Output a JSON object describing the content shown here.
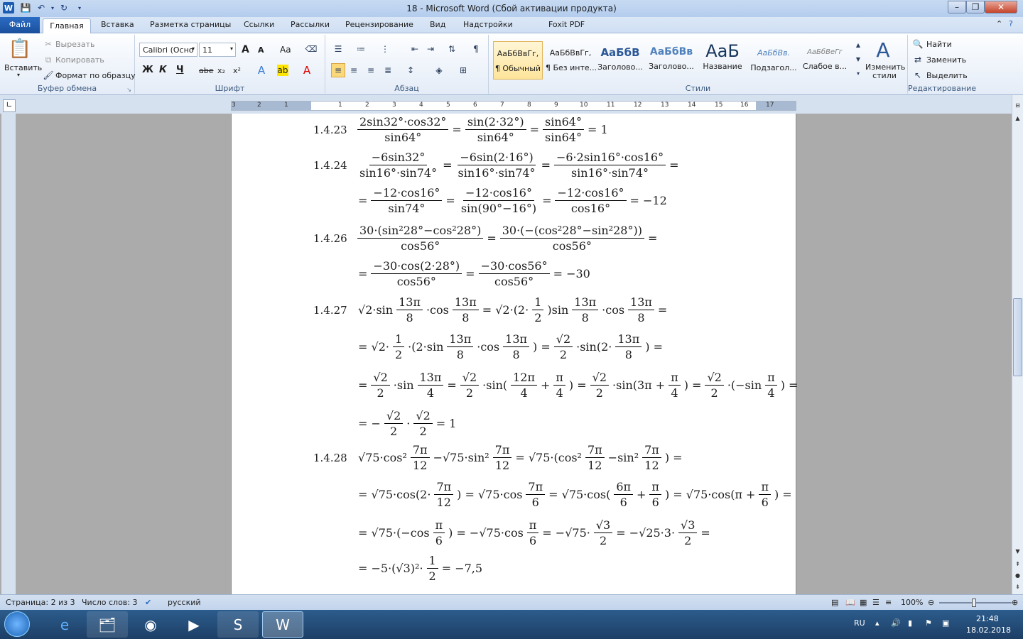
{
  "window": {
    "title": "18 - Microsoft Word (Сбой активации продукта)"
  },
  "tabs": [
    "Файл",
    "Главная",
    "Вставка",
    "Разметка страницы",
    "Ссылки",
    "Рассылки",
    "Рецензирование",
    "Вид",
    "Надстройки",
    "Foxit PDF"
  ],
  "clipboard": {
    "paste": "Вставить",
    "cut": "Вырезать",
    "copy": "Копировать",
    "format_painter": "Формат по образцу",
    "label": "Буфер обмена"
  },
  "font": {
    "name": "Calibri (Осно",
    "size": "11",
    "label": "Шрифт",
    "bold": "Ж",
    "italic": "К",
    "underline": "Ч",
    "strike": "abe",
    "sub": "x₂",
    "sup": "x²",
    "grow": "A",
    "shrink": "A",
    "case": "Aa"
  },
  "paragraph": {
    "label": "Абзац"
  },
  "styles": {
    "label": "Стили",
    "items": [
      {
        "preview": "АаБбВвГг,",
        "name": "¶ Обычный"
      },
      {
        "preview": "АаБбВвГг,",
        "name": "¶ Без инте..."
      },
      {
        "preview": "АаБбВ",
        "name": "Заголово..."
      },
      {
        "preview": "АаБбВв",
        "name": "Заголово..."
      },
      {
        "preview": "АаБ",
        "name": "Название"
      },
      {
        "preview": "АаБбВв.",
        "name": "Подзагол..."
      },
      {
        "preview": "АаБбВеГг",
        "name": "Слабое в..."
      }
    ],
    "change": "Изменить стили"
  },
  "editing": {
    "label": "Редактирование",
    "find": "Найти",
    "replace": "Заменить",
    "select": "Выделить"
  },
  "ruler": {
    "numbers": [
      "3",
      "2",
      "1",
      "1",
      "2",
      "3",
      "4",
      "5",
      "6",
      "7",
      "8",
      "9",
      "10",
      "11",
      "12",
      "13",
      "14",
      "15",
      "16",
      "17"
    ]
  },
  "document": {
    "lines": [
      {
        "label": "1.4.23",
        "parts": [
          [
            "2sin32°·cos32°",
            "sin64°"
          ],
          "=",
          [
            "sin(2·32°)",
            "sin64°"
          ],
          "=",
          [
            "sin64°",
            "sin64°"
          ],
          "= 1"
        ]
      },
      {
        "label": "1.4.24",
        "parts": [
          [
            "−6sin32°",
            "sin16°·sin74°"
          ],
          "=",
          [
            "−6sin(2·16°)",
            "sin16°·sin74°"
          ],
          "=",
          [
            "−6·2sin16°·cos16°",
            "sin16°·sin74°"
          ],
          "="
        ]
      },
      {
        "label": "",
        "parts": [
          "=",
          [
            "−12·cos16°",
            "sin74°"
          ],
          "=",
          [
            "−12·cos16°",
            "sin(90°−16°)"
          ],
          "=",
          [
            "−12·cos16°",
            "cos16°"
          ],
          "= −12"
        ]
      },
      {
        "label": "1.4.26",
        "parts": [
          [
            "30·(sin²28°−cos²28°)",
            "cos56°"
          ],
          "=",
          [
            "30·(−(cos²28°−sin²28°))",
            "cos56°"
          ],
          "="
        ]
      },
      {
        "label": "",
        "parts": [
          "=",
          [
            "−30·cos(2·28°)",
            "cos56°"
          ],
          "=",
          [
            "−30·cos56°",
            "cos56°"
          ],
          "= −30"
        ]
      },
      {
        "label": "1.4.27",
        "parts": [
          "√2·sin",
          [
            "13π",
            "8"
          ],
          "·cos",
          [
            "13π",
            "8"
          ],
          "= √2·(2·",
          [
            "1",
            "2"
          ],
          ")sin",
          [
            "13π",
            "8"
          ],
          "·cos",
          [
            "13π",
            "8"
          ],
          "="
        ]
      },
      {
        "label": "",
        "parts": [
          "= √2·",
          [
            "1",
            "2"
          ],
          "·(2·sin",
          [
            "13π",
            "8"
          ],
          "·cos",
          [
            "13π",
            "8"
          ],
          ") =",
          [
            "√2",
            "2"
          ],
          "·sin(2·",
          [
            "13π",
            "8"
          ],
          ") ="
        ]
      },
      {
        "label": "",
        "parts": [
          "=",
          [
            "√2",
            "2"
          ],
          "·sin",
          [
            "13π",
            "4"
          ],
          "=",
          [
            "√2",
            "2"
          ],
          "·sin(",
          [
            "12π",
            "4"
          ],
          "+",
          [
            "π",
            "4"
          ],
          ") =",
          [
            "√2",
            "2"
          ],
          "·sin(3π +",
          [
            "π",
            "4"
          ],
          ") =",
          [
            "√2",
            "2"
          ],
          "·(−sin",
          [
            "π",
            "4"
          ],
          ") ="
        ]
      },
      {
        "label": "",
        "parts": [
          "= −",
          [
            "√2",
            "2"
          ],
          "·",
          [
            "√2",
            "2"
          ],
          "= 1"
        ]
      },
      {
        "label": "1.4.28",
        "parts": [
          "√75·cos²",
          [
            "7π",
            "12"
          ],
          "−√75·sin²",
          [
            "7π",
            "12"
          ],
          "= √75·(cos²",
          [
            "7π",
            "12"
          ],
          "−sin²",
          [
            "7π",
            "12"
          ],
          ") ="
        ]
      },
      {
        "label": "",
        "parts": [
          "= √75·cos(2·",
          [
            "7π",
            "12"
          ],
          ") = √75·cos",
          [
            "7π",
            "6"
          ],
          "= √75·cos(",
          [
            "6π",
            "6"
          ],
          "+",
          [
            "π",
            "6"
          ],
          ") = √75·cos(π +",
          [
            "π",
            "6"
          ],
          ") ="
        ]
      },
      {
        "label": "",
        "parts": [
          "= √75·(−cos",
          [
            "π",
            "6"
          ],
          ") = −√75·cos",
          [
            "π",
            "6"
          ],
          "= −√75·",
          [
            "√3",
            "2"
          ],
          "= −√25·3·",
          [
            "√3",
            "2"
          ],
          "="
        ]
      },
      {
        "label": "",
        "parts": [
          "= −5·(√3)²·",
          [
            "1",
            "2"
          ],
          "= −7,5"
        ]
      }
    ]
  },
  "status": {
    "page": "Страница: 2 из 3",
    "words": "Число слов: 3",
    "lang": "русский",
    "zoom": "100%"
  },
  "tray": {
    "lang": "RU",
    "time": "21:48",
    "date": "18.02.2018"
  }
}
